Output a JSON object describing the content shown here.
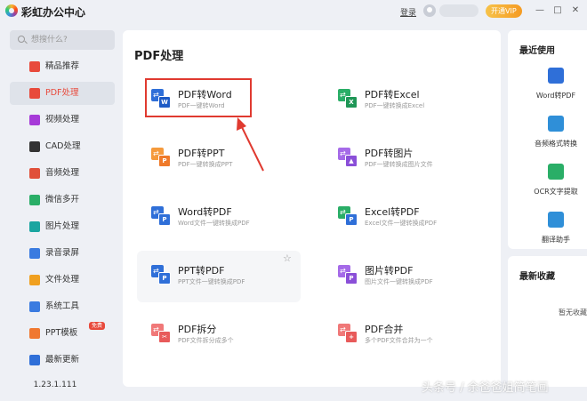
{
  "app": {
    "title": "彩虹办公中心",
    "login": "登录",
    "vip": "开通VIP"
  },
  "window": {
    "minimize": "—",
    "maximize": "□",
    "close": "✕"
  },
  "sidebar": {
    "search_placeholder": "想搜什么?",
    "items": [
      {
        "label": "精品推荐",
        "icon": "recommend-icon",
        "color": "#e84a3c"
      },
      {
        "label": "PDF处理",
        "icon": "pdf-icon",
        "color": "#e84a3c",
        "active": true
      },
      {
        "label": "视频处理",
        "icon": "video-icon",
        "color": "#a63ad8"
      },
      {
        "label": "CAD处理",
        "icon": "cad-icon",
        "color": "#333333"
      },
      {
        "label": "音频处理",
        "icon": "audio-icon",
        "color": "#e0503a"
      },
      {
        "label": "微信多开",
        "icon": "wechat-icon",
        "color": "#2aae67"
      },
      {
        "label": "图片处理",
        "icon": "image-icon",
        "color": "#1aa5a0"
      },
      {
        "label": "录音录屏",
        "icon": "record-icon",
        "color": "#3a7be0"
      },
      {
        "label": "文件处理",
        "icon": "file-icon",
        "color": "#f0a020"
      },
      {
        "label": "系统工具",
        "icon": "system-icon",
        "color": "#3a7be0"
      },
      {
        "label": "PPT模板",
        "icon": "ppt-template-icon",
        "color": "#f07830",
        "badge": "免费"
      },
      {
        "label": "最新更新",
        "icon": "update-icon",
        "color": "#2f6fd8"
      }
    ],
    "version": "1.23.1.111"
  },
  "main": {
    "title": "PDF处理",
    "tools": [
      {
        "name": "PDF转Word",
        "desc": "PDF一键转Word",
        "icon": "pdf-to-word-icon",
        "c1": "#2f6fd8",
        "c2": "#1e5bc6",
        "letter": "W"
      },
      {
        "name": "PDF转Excel",
        "desc": "PDF一键转换成Excel",
        "icon": "pdf-to-excel-icon",
        "c1": "#2aae67",
        "c2": "#1f9656",
        "letter": "X"
      },
      {
        "name": "PDF转PPT",
        "desc": "PDF一键转换成PPT",
        "icon": "pdf-to-ppt-icon",
        "c1": "#f59a3c",
        "c2": "#ef7a2a",
        "letter": "P"
      },
      {
        "name": "PDF转图片",
        "desc": "PDF一键转换成图片文件",
        "icon": "pdf-to-image-icon",
        "c1": "#a56ae8",
        "c2": "#8a4fd8",
        "letter": "▲"
      },
      {
        "name": "Word转PDF",
        "desc": "Word文件一键转换成PDF",
        "icon": "word-to-pdf-icon",
        "c1": "#2f6fd8",
        "c2": "#2f6fd8",
        "letter": "P"
      },
      {
        "name": "Excel转PDF",
        "desc": "Excel文件一键转换成PDF",
        "icon": "excel-to-pdf-icon",
        "c1": "#2aae67",
        "c2": "#2f6fd8",
        "letter": "P"
      },
      {
        "name": "PPT转PDF",
        "desc": "PPT文件一键转换成PDF",
        "icon": "ppt-to-pdf-icon",
        "c1": "#2f6fd8",
        "c2": "#2f6fd8",
        "letter": "P"
      },
      {
        "name": "图片转PDF",
        "desc": "图片文件一键转换成PDF",
        "icon": "image-to-pdf-icon",
        "c1": "#a56ae8",
        "c2": "#8a4fd8",
        "letter": "P"
      },
      {
        "name": "PDF拆分",
        "desc": "PDF文件拆分成多个",
        "icon": "pdf-split-icon",
        "c1": "#f07878",
        "c2": "#e85a5a",
        "letter": "✂"
      },
      {
        "name": "PDF合并",
        "desc": "多个PDF文件合并为一个",
        "icon": "pdf-merge-icon",
        "c1": "#f07878",
        "c2": "#e85a5a",
        "letter": "+"
      }
    ]
  },
  "recent": {
    "title": "最近使用",
    "items": [
      {
        "label": "Word转PDF",
        "icon": "word-to-pdf-icon",
        "color": "#2f6fd8"
      },
      {
        "label": "音频格式转换",
        "icon": "audio-convert-icon",
        "color": "#2f8fd8"
      },
      {
        "label": "OCR文字提取",
        "icon": "ocr-icon",
        "color": "#2aae67"
      },
      {
        "label": "翻译助手",
        "icon": "translate-icon",
        "color": "#2f8fd8"
      }
    ]
  },
  "favorites": {
    "title": "最新收藏",
    "empty": "暂无收藏"
  },
  "watermark": "头条号 / 余爸爸姐简笔画"
}
